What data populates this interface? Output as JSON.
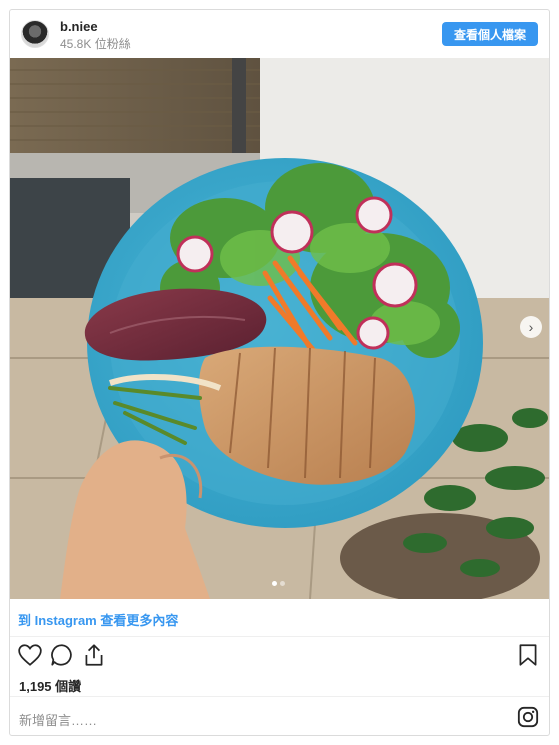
{
  "header": {
    "username": "b.niee",
    "followers": "45.8K 位粉絲",
    "profile_button": "查看個人檔案"
  },
  "post": {
    "more_link": "到 Instagram 查看更多內容",
    "likes": "1,195 個讚",
    "comment_placeholder": "新增留言……",
    "carousel_count": 2,
    "carousel_active_index": 0
  },
  "icons": {
    "like": "heart-icon",
    "comment": "comment-icon",
    "share": "share-icon",
    "save": "bookmark-icon",
    "next": "chevron-right-icon",
    "brand": "instagram-logo-icon"
  },
  "colors": {
    "accent": "#3897f0",
    "text": "#262626",
    "muted": "#8e8e8e",
    "border": "#dbdbdb"
  }
}
